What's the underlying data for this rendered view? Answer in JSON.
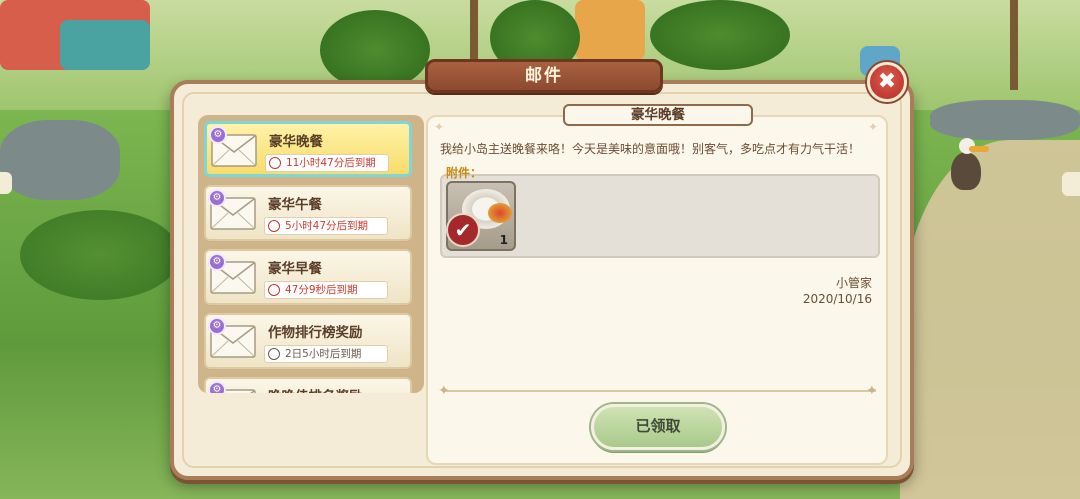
{
  "window": {
    "title": "邮件"
  },
  "mail_list": [
    {
      "title": "豪华晚餐",
      "expire": "11小时47分后到期",
      "selected": true,
      "urgent": true
    },
    {
      "title": "豪华午餐",
      "expire": "5小时47分后到期",
      "selected": false,
      "urgent": true
    },
    {
      "title": "豪华早餐",
      "expire": "47分9秒后到期",
      "selected": false,
      "urgent": true
    },
    {
      "title": "作物排行榜奖励",
      "expire": "2日5小时后到期",
      "selected": false,
      "urgent": false
    },
    {
      "title": "晚晚佳排名奖励",
      "expire": "",
      "selected": false,
      "urgent": false
    }
  ],
  "detail": {
    "title": "豪华晚餐",
    "body": "我给小岛主送晚餐来咯！今天是美味的意面哦！别客气，多吃点才有力气干活！",
    "attachment_label": "附件：",
    "attachment": {
      "icon": "pasta-dish-icon",
      "quantity": "1",
      "claimed": true
    },
    "sender": "小管家",
    "date": "2020/10/16",
    "claim_button": "已领取"
  },
  "colors": {
    "accent_banner": "#8d4a2f",
    "expire_red": "#d03a2e",
    "selected_bg": "#f8dc6a",
    "claim_button": "#a9c98a"
  }
}
